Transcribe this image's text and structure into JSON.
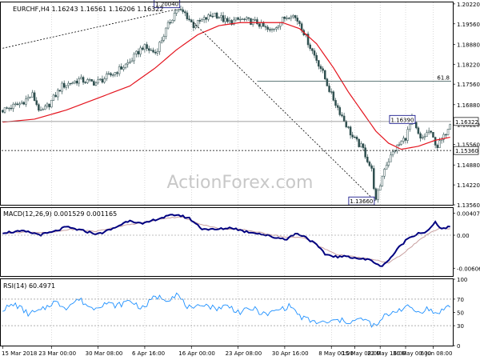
{
  "colors": {
    "background": "#ffffff",
    "frame": "#000000",
    "candle": "#2f4f4f",
    "ma": "#e4141e",
    "macd_line": "#000080",
    "signal_line": "#c8a0a0",
    "rsi_line": "#1e90ff",
    "trend_line": "#000000",
    "fib_line": "#2f4f4f",
    "watermark": "#c8c8c8"
  },
  "watermark": "ActionForex.com",
  "chart_data": [
    {
      "type": "candlestick",
      "title": "EURCHF,H4  1.16243 1.16561 1.16206 1.16322",
      "ylim": [
        1.1356,
        1.2027
      ],
      "y_ticks": [
        "1.20220",
        "1.19560",
        "1.18880",
        "1.18220",
        "1.17560",
        "1.16880",
        "1.16220",
        "1.15560",
        "1.14880",
        "1.14220",
        "1.13560"
      ],
      "y_tick_values": [
        1.2022,
        1.1956,
        1.1888,
        1.1822,
        1.1756,
        1.1688,
        1.1622,
        1.1556,
        1.1488,
        1.1422,
        1.1356
      ],
      "current_price": 1.16322,
      "current_price_label": "1.16322",
      "support_price": 1.1536,
      "support_label": "1.15360",
      "annotations": [
        {
          "id": "hi",
          "text": "1.20040",
          "value": 1.2004,
          "bar": 82
        },
        {
          "id": "sw",
          "text": "1.16390",
          "value": 1.1639,
          "bar": 193
        },
        {
          "id": "lo",
          "text": "1.13660",
          "value": 1.1366,
          "bar": 176
        }
      ],
      "fib": {
        "text": "61.8",
        "value": 1.1766
      },
      "price_path": [
        [
          0,
          1.167
        ],
        [
          8,
          1.169
        ],
        [
          14,
          1.172
        ],
        [
          18,
          1.166
        ],
        [
          22,
          1.169
        ],
        [
          28,
          1.175
        ],
        [
          36,
          1.177
        ],
        [
          44,
          1.176
        ],
        [
          52,
          1.179
        ],
        [
          60,
          1.183
        ],
        [
          66,
          1.188
        ],
        [
          72,
          1.186
        ],
        [
          78,
          1.195
        ],
        [
          82,
          1.2004
        ],
        [
          86,
          1.199
        ],
        [
          90,
          1.195
        ],
        [
          95,
          1.197
        ],
        [
          100,
          1.199
        ],
        [
          106,
          1.196
        ],
        [
          112,
          1.197
        ],
        [
          120,
          1.196
        ],
        [
          126,
          1.193
        ],
        [
          132,
          1.197
        ],
        [
          136,
          1.199
        ],
        [
          140,
          1.196
        ],
        [
          145,
          1.188
        ],
        [
          150,
          1.181
        ],
        [
          155,
          1.172
        ],
        [
          160,
          1.165
        ],
        [
          165,
          1.158
        ],
        [
          170,
          1.154
        ],
        [
          174,
          1.147
        ],
        [
          176,
          1.1366
        ],
        [
          180,
          1.148
        ],
        [
          185,
          1.154
        ],
        [
          190,
          1.158
        ],
        [
          193,
          1.1639
        ],
        [
          197,
          1.157
        ],
        [
          201,
          1.16
        ],
        [
          205,
          1.155
        ],
        [
          208,
          1.158
        ],
        [
          211,
          1.1632
        ]
      ],
      "ma_path": [
        [
          0,
          1.163
        ],
        [
          15,
          1.164
        ],
        [
          30,
          1.167
        ],
        [
          45,
          1.171
        ],
        [
          60,
          1.175
        ],
        [
          72,
          1.181
        ],
        [
          82,
          1.187
        ],
        [
          92,
          1.192
        ],
        [
          102,
          1.195
        ],
        [
          112,
          1.196
        ],
        [
          122,
          1.196
        ],
        [
          132,
          1.196
        ],
        [
          140,
          1.194
        ],
        [
          148,
          1.189
        ],
        [
          156,
          1.181
        ],
        [
          163,
          1.173
        ],
        [
          170,
          1.166
        ],
        [
          176,
          1.16
        ],
        [
          182,
          1.156
        ],
        [
          188,
          1.154
        ],
        [
          196,
          1.155
        ],
        [
          204,
          1.157
        ],
        [
          211,
          1.158
        ]
      ],
      "trendlines": [
        {
          "from": [
            0,
            1.1875
          ],
          "to": [
            82,
            1.2004
          ]
        },
        {
          "from": [
            90,
            1.196
          ],
          "to": [
            176,
            1.1366
          ]
        }
      ]
    },
    {
      "type": "line",
      "title": "MACD(12,26,9) 0.001529 0.001165",
      "ylim": [
        -0.0075,
        0.005
      ],
      "y_ticks": [
        "0.004071",
        "0.00",
        "-0.006069"
      ],
      "y_tick_values": [
        0.004071,
        0.0,
        -0.006069
      ],
      "series": [
        {
          "id": "macd",
          "values_path": [
            [
              0,
              0.0005
            ],
            [
              10,
              0.0007
            ],
            [
              18,
              0.0001
            ],
            [
              24,
              0.0006
            ],
            [
              30,
              0.0015
            ],
            [
              38,
              0.0008
            ],
            [
              45,
              0.0002
            ],
            [
              52,
              0.0012
            ],
            [
              60,
              0.0028
            ],
            [
              66,
              0.002
            ],
            [
              72,
              0.0029
            ],
            [
              78,
              0.0035
            ],
            [
              82,
              0.0038
            ],
            [
              88,
              0.0031
            ],
            [
              94,
              0.0012
            ],
            [
              100,
              0.001
            ],
            [
              108,
              0.0014
            ],
            [
              114,
              0.0007
            ],
            [
              120,
              0.0004
            ],
            [
              128,
              -0.0004
            ],
            [
              134,
              -0.0007
            ],
            [
              138,
              0.0003
            ],
            [
              142,
              -0.0001
            ],
            [
              148,
              -0.0018
            ],
            [
              152,
              -0.0035
            ],
            [
              158,
              -0.004
            ],
            [
              163,
              -0.0039
            ],
            [
              168,
              -0.0043
            ],
            [
              174,
              -0.0046
            ],
            [
              178,
              -0.0058
            ],
            [
              182,
              -0.0046
            ],
            [
              187,
              -0.0022
            ],
            [
              191,
              -0.0006
            ],
            [
              196,
              0.0004
            ],
            [
              200,
              0.0006
            ],
            [
              204,
              0.0023
            ],
            [
              207,
              0.0012
            ],
            [
              211,
              0.0015
            ]
          ]
        },
        {
          "id": "signal",
          "values_path": [
            [
              0,
              0.0004
            ],
            [
              12,
              0.0006
            ],
            [
              22,
              0.0004
            ],
            [
              32,
              0.0011
            ],
            [
              44,
              0.0007
            ],
            [
              56,
              0.0017
            ],
            [
              66,
              0.0023
            ],
            [
              76,
              0.0031
            ],
            [
              84,
              0.0034
            ],
            [
              92,
              0.0022
            ],
            [
              102,
              0.0012
            ],
            [
              114,
              0.001
            ],
            [
              124,
              0.0003
            ],
            [
              134,
              -0.0004
            ],
            [
              142,
              -0.0004
            ],
            [
              150,
              -0.0022
            ],
            [
              158,
              -0.0036
            ],
            [
              168,
              -0.0041
            ],
            [
              176,
              -0.0046
            ],
            [
              182,
              -0.0051
            ],
            [
              188,
              -0.0036
            ],
            [
              194,
              -0.0017
            ],
            [
              200,
              0.0001
            ],
            [
              206,
              0.0013
            ],
            [
              211,
              0.0012
            ]
          ]
        }
      ]
    },
    {
      "type": "line",
      "title": "RSI(14) 60.4971",
      "ylim": [
        0,
        100
      ],
      "y_ticks": [
        "100",
        "70",
        "50",
        "30",
        "0"
      ],
      "y_tick_values": [
        100,
        70,
        50,
        30,
        0
      ],
      "levels": [
        70,
        30
      ],
      "series": [
        {
          "id": "rsi",
          "values_path": [
            [
              0,
              55
            ],
            [
              6,
              62
            ],
            [
              12,
              48
            ],
            [
              18,
              52
            ],
            [
              24,
              66
            ],
            [
              30,
              58
            ],
            [
              36,
              70
            ],
            [
              42,
              56
            ],
            [
              48,
              64
            ],
            [
              54,
              60
            ],
            [
              60,
              68
            ],
            [
              66,
              56
            ],
            [
              72,
              74
            ],
            [
              78,
              70
            ],
            [
              82,
              78
            ],
            [
              86,
              62
            ],
            [
              90,
              52
            ],
            [
              94,
              64
            ],
            [
              100,
              56
            ],
            [
              106,
              60
            ],
            [
              112,
              50
            ],
            [
              118,
              56
            ],
            [
              124,
              46
            ],
            [
              130,
              54
            ],
            [
              136,
              60
            ],
            [
              140,
              44
            ],
            [
              146,
              36
            ],
            [
              152,
              34
            ],
            [
              158,
              38
            ],
            [
              164,
              36
            ],
            [
              170,
              40
            ],
            [
              176,
              28
            ],
            [
              180,
              44
            ],
            [
              186,
              54
            ],
            [
              192,
              58
            ],
            [
              196,
              50
            ],
            [
              200,
              56
            ],
            [
              204,
              48
            ],
            [
              208,
              55
            ],
            [
              211,
              60
            ]
          ]
        }
      ]
    }
  ],
  "x_axis": {
    "bar_count": 212,
    "ticks": [
      {
        "label": "15 Mar 2018",
        "bar": 0
      },
      {
        "label": "23 Mar 00:00",
        "bar": 23
      },
      {
        "label": "30 Mar 08:00",
        "bar": 45
      },
      {
        "label": "6 Apr 16:00",
        "bar": 67
      },
      {
        "label": "16 Apr 00:00",
        "bar": 89
      },
      {
        "label": "23 Apr 08:00",
        "bar": 111
      },
      {
        "label": "30 Apr 16:00",
        "bar": 133
      },
      {
        "label": "8 May 00:00",
        "bar": 155
      },
      {
        "label": "15 May 08:00",
        "bar": 166
      },
      {
        "label": "22 May 16:00",
        "bar": 178
      },
      {
        "label": "30 May 00:00",
        "bar": 190
      },
      {
        "label": "6 Jun 08:00",
        "bar": 203
      }
    ]
  }
}
